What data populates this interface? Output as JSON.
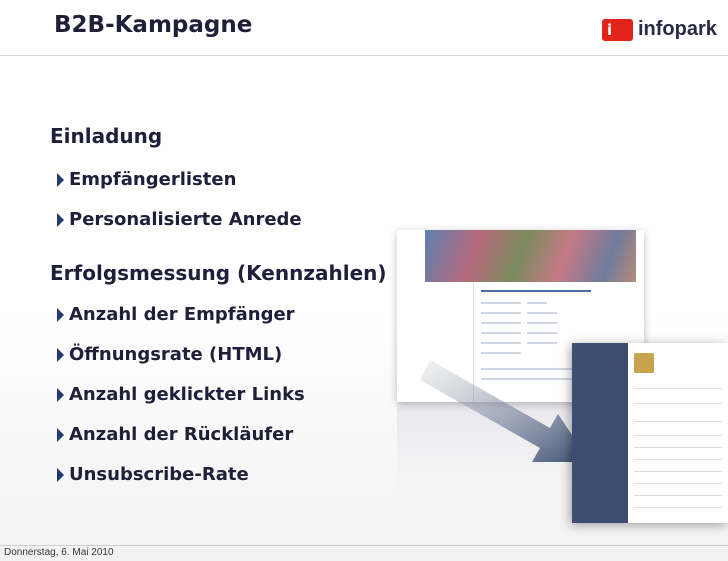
{
  "header": {
    "title": "B2B-Kampagne",
    "logo_text": "infopark",
    "logo_icon": "infopark-logo-icon"
  },
  "content": {
    "sections": [
      {
        "heading": "Einladung",
        "bullets": [
          "Empfängerlisten",
          "Personalisierte Anrede"
        ]
      },
      {
        "heading": "Erfolgsmessung (Kennzahlen)",
        "bullets": [
          "Anzahl der Empfänger",
          "Öffnungsrate (HTML)",
          "Anzahl geklickter Links",
          "Anzahl der Rückläufer",
          "Unsubscribe-Rate"
        ]
      }
    ]
  },
  "footer": {
    "date": "Donnerstag, 6. Mai 2010"
  },
  "colors": {
    "title": "#1f1f3a",
    "bullet_arrow": "#1f3a6e",
    "logo_red": "#e2231a",
    "sidebar_blue": "#3c4f73"
  }
}
